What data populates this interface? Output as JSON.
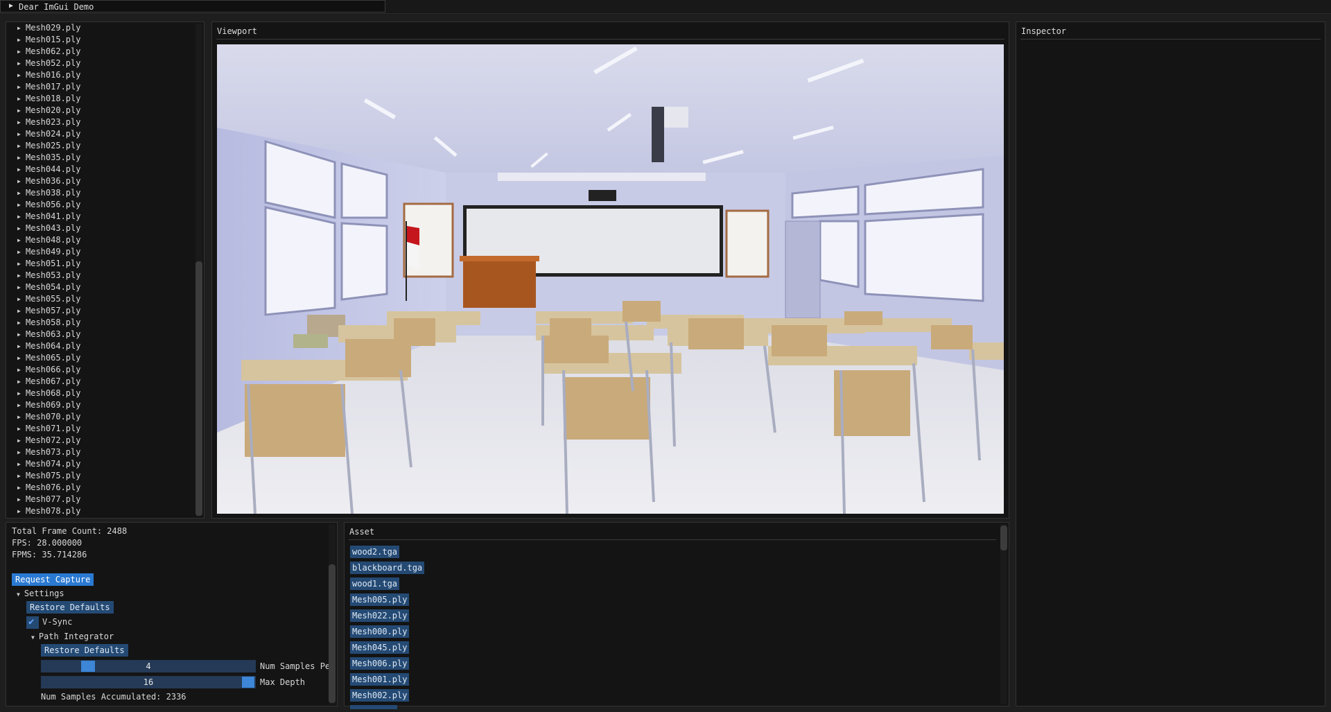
{
  "menu": {
    "demo_window_label": "Dear ImGui Demo"
  },
  "scene": {
    "items": [
      "Mesh029.ply",
      "Mesh015.ply",
      "Mesh062.ply",
      "Mesh052.ply",
      "Mesh016.ply",
      "Mesh017.ply",
      "Mesh018.ply",
      "Mesh020.ply",
      "Mesh023.ply",
      "Mesh024.ply",
      "Mesh025.ply",
      "Mesh035.ply",
      "Mesh044.ply",
      "Mesh036.ply",
      "Mesh038.ply",
      "Mesh056.ply",
      "Mesh041.ply",
      "Mesh043.ply",
      "Mesh048.ply",
      "Mesh049.ply",
      "Mesh051.ply",
      "Mesh053.ply",
      "Mesh054.ply",
      "Mesh055.ply",
      "Mesh057.ply",
      "Mesh058.ply",
      "Mesh063.ply",
      "Mesh064.ply",
      "Mesh065.ply",
      "Mesh066.ply",
      "Mesh067.ply",
      "Mesh068.ply",
      "Mesh069.ply",
      "Mesh070.ply",
      "Mesh071.ply",
      "Mesh072.ply",
      "Mesh073.ply",
      "Mesh074.ply",
      "Mesh075.ply",
      "Mesh076.ply",
      "Mesh077.ply",
      "Mesh078.ply"
    ]
  },
  "viewport": {
    "title": "Viewport"
  },
  "inspector": {
    "title": "Inspector"
  },
  "stats": {
    "total_frame_count": "Total Frame Count: 2488",
    "fps": "FPS: 28.000000",
    "fpms": "FPMS: 35.714286",
    "request_capture": "Request Capture",
    "settings_label": "Settings",
    "restore_defaults": "Restore Defaults",
    "vsync_label": "V-Sync",
    "vsync_checked": true,
    "path_integrator_label": "Path Integrator",
    "pi_restore_defaults": "Restore Defaults",
    "num_samples_value": "4",
    "num_samples_label": "Num Samples Pe",
    "max_depth_value": "16",
    "max_depth_label": "Max Depth",
    "num_samples_accumulated": "Num Samples Accumulated: 2336"
  },
  "asset": {
    "title": "Asset",
    "items": [
      "wood2.tga",
      "blackboard.tga",
      "wood1.tga",
      "Mesh005.ply",
      "Mesh022.ply",
      "Mesh000.ply",
      "Mesh045.ply",
      "Mesh006.ply",
      "Mesh001.ply",
      "Mesh002.ply"
    ]
  },
  "colors": {
    "accent": "#2a79d2",
    "button": "#244a74",
    "panel_bg": "#141414"
  }
}
